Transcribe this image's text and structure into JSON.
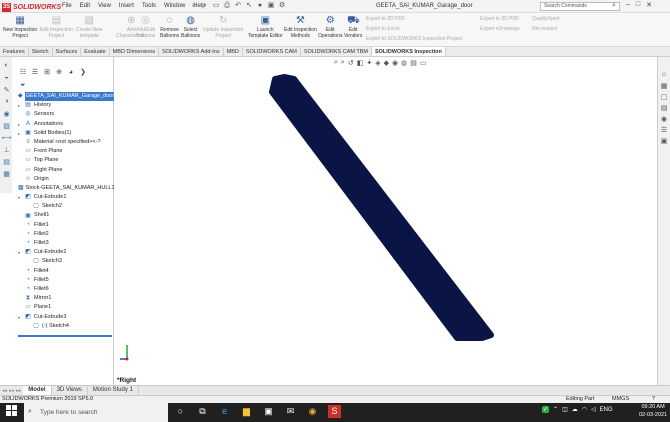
{
  "title_bar": {
    "logo_text": "SOLIDWORKS",
    "menus": [
      "File",
      "Edit",
      "View",
      "Insert",
      "Tools",
      "Window",
      "Help"
    ],
    "document_title": "GEETA_SAI_KUMAR_Garage_door",
    "search_placeholder": "Search Commands"
  },
  "command_manager": {
    "buttons": [
      {
        "line1": "New Inspection",
        "line2": "Project",
        "enabled": true
      },
      {
        "line1": "Edit Inspection",
        "line2": "Project",
        "enabled": false
      },
      {
        "line1": "Create New",
        "line2": "template",
        "enabled": false
      },
      {
        "line1": "Add",
        "line2": "Characteristic",
        "enabled": false
      },
      {
        "line1": "Add/Edit",
        "line2": "Balloons",
        "enabled": false
      },
      {
        "line1": "Remove",
        "line2": "Balloons",
        "enabled": true
      },
      {
        "line1": "Select",
        "line2": "Balloons",
        "enabled": true
      },
      {
        "line1": "Update Inspection",
        "line2": "Project",
        "enabled": false
      },
      {
        "line1": "Launch",
        "line2": "Template Editor",
        "enabled": true
      },
      {
        "line1": "Edit Inspection",
        "line2": "Methods",
        "enabled": true
      },
      {
        "line1": "Edit",
        "line2": "Operations",
        "enabled": true
      },
      {
        "line1": "Edit",
        "line2": "Vendors",
        "enabled": true
      }
    ],
    "export_items": [
      "Export to 2D PDF",
      "Export to Excel",
      "Export to SOLIDWORKS Inspection Project"
    ],
    "export_items_2": [
      "Export to 3D PDF",
      "Export eDrawings"
    ],
    "quality_items": [
      "QualityXpert",
      "Net-inspect"
    ]
  },
  "tabs": [
    "Features",
    "Sketch",
    "Surfaces",
    "Evaluate",
    "MBD Dimensions",
    "SOLIDWORKS Add-Ins",
    "MBD",
    "SOLIDWORKS CAM",
    "SOLIDWORKS CAM TBM",
    "SOLIDWORKS Inspection"
  ],
  "active_tab": "SOLIDWORKS Inspection",
  "feature_tree": [
    {
      "label": "GEETA_SAI_KUMAR_Garage_door (D",
      "indent": 0,
      "arrow": "",
      "icon": "part-icon"
    },
    {
      "label": "History",
      "indent": 0,
      "arrow": "▸",
      "icon": "history-icon"
    },
    {
      "label": "Sensors",
      "indent": 0,
      "arrow": "",
      "icon": "sensor-icon"
    },
    {
      "label": "Annotations",
      "indent": 0,
      "arrow": "▸",
      "icon": "annotation-icon"
    },
    {
      "label": "Solid Bodies(1)",
      "indent": 0,
      "arrow": "▸",
      "icon": "solid-body-icon"
    },
    {
      "label": "Material <not specified><-?",
      "indent": 0,
      "arrow": "",
      "icon": "material-icon"
    },
    {
      "label": "Front Plane",
      "indent": 0,
      "arrow": "",
      "icon": "plane-icon"
    },
    {
      "label": "Top Plane",
      "indent": 0,
      "arrow": "",
      "icon": "plane-icon"
    },
    {
      "label": "Right Plane",
      "indent": 0,
      "arrow": "",
      "icon": "plane-icon"
    },
    {
      "label": "Origin",
      "indent": 0,
      "arrow": "",
      "icon": "origin-icon"
    },
    {
      "label": "Stock-GEETA_SAI_KUMAR_HULL1",
      "indent": 0,
      "arrow": "",
      "icon": "stock-icon"
    },
    {
      "label": "Cut-Extrude1",
      "indent": 0,
      "arrow": "▾",
      "icon": "cut-extrude-icon"
    },
    {
      "label": "Sketch2",
      "indent": 1,
      "arrow": "",
      "icon": "sketch-icon"
    },
    {
      "label": "Shell1",
      "indent": 0,
      "arrow": "",
      "icon": "shell-icon"
    },
    {
      "label": "Fillet1",
      "indent": 0,
      "arrow": "",
      "icon": "fillet-icon"
    },
    {
      "label": "Fillet2",
      "indent": 0,
      "arrow": "",
      "icon": "fillet-icon"
    },
    {
      "label": "Fillet3",
      "indent": 0,
      "arrow": "",
      "icon": "fillet-icon"
    },
    {
      "label": "Cut-Extrude2",
      "indent": 0,
      "arrow": "▾",
      "icon": "cut-extrude-icon"
    },
    {
      "label": "Sketch3",
      "indent": 1,
      "arrow": "",
      "icon": "sketch-icon"
    },
    {
      "label": "Fillet4",
      "indent": 0,
      "arrow": "",
      "icon": "fillet-icon"
    },
    {
      "label": "Fillet5",
      "indent": 0,
      "arrow": "",
      "icon": "fillet-icon"
    },
    {
      "label": "Fillet6",
      "indent": 0,
      "arrow": "",
      "icon": "fillet-icon"
    },
    {
      "label": "Mirror1",
      "indent": 0,
      "arrow": "",
      "icon": "mirror-icon"
    },
    {
      "label": "Plane1",
      "indent": 0,
      "arrow": "",
      "icon": "plane-icon"
    },
    {
      "label": "Cut-Extrude3",
      "indent": 0,
      "arrow": "▾",
      "icon": "cut-extrude-icon"
    },
    {
      "label": "(-) Sketch4",
      "indent": 1,
      "arrow": "",
      "icon": "sketch-icon"
    }
  ],
  "viewport": {
    "view_label": "*Right",
    "part_color": "#0a1445"
  },
  "model_tabs": [
    "Model",
    "3D Views",
    "Motion Study 1"
  ],
  "active_model_tab": "Model",
  "status_bar": {
    "left": "SOLIDWORKS Premium 2019 SP5.0",
    "mode": "Editing Part",
    "units": "MMGS"
  },
  "taskbar": {
    "search_placeholder": "Type here to search",
    "tray_lang": "ENG",
    "time": "09:20 AM",
    "date": "02-03-2021"
  }
}
